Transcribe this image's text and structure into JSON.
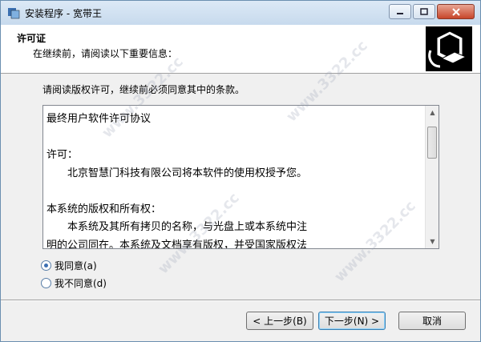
{
  "window": {
    "title": "安装程序 - 宽带王"
  },
  "header": {
    "title": "许可证",
    "subtitle": "在继续前，请阅读以下重要信息："
  },
  "instruction": "请阅读版权许可，继续前必须同意其中的条款。",
  "license": {
    "text": "最终用户软件许可协议\n\n许可：\n　　北京智慧门科技有限公司将本软件的使用权授予您。\n\n本系统的版权和所有权：\n　　本系统及其所有拷贝的名称，与光盘上或本系统中注\n明的公司同在。本系统及文档享有版权，并受国家版权法\n及国际协约条款的保护。您不可以从本软件中去掉其版权"
  },
  "options": {
    "agree": "我同意(a)",
    "disagree": "我不同意(d)",
    "selected": "agree"
  },
  "buttons": {
    "back": "< 上一步(B)",
    "next": "下一步(N) >",
    "cancel": "取消"
  },
  "watermark": "www.3322.cc"
}
